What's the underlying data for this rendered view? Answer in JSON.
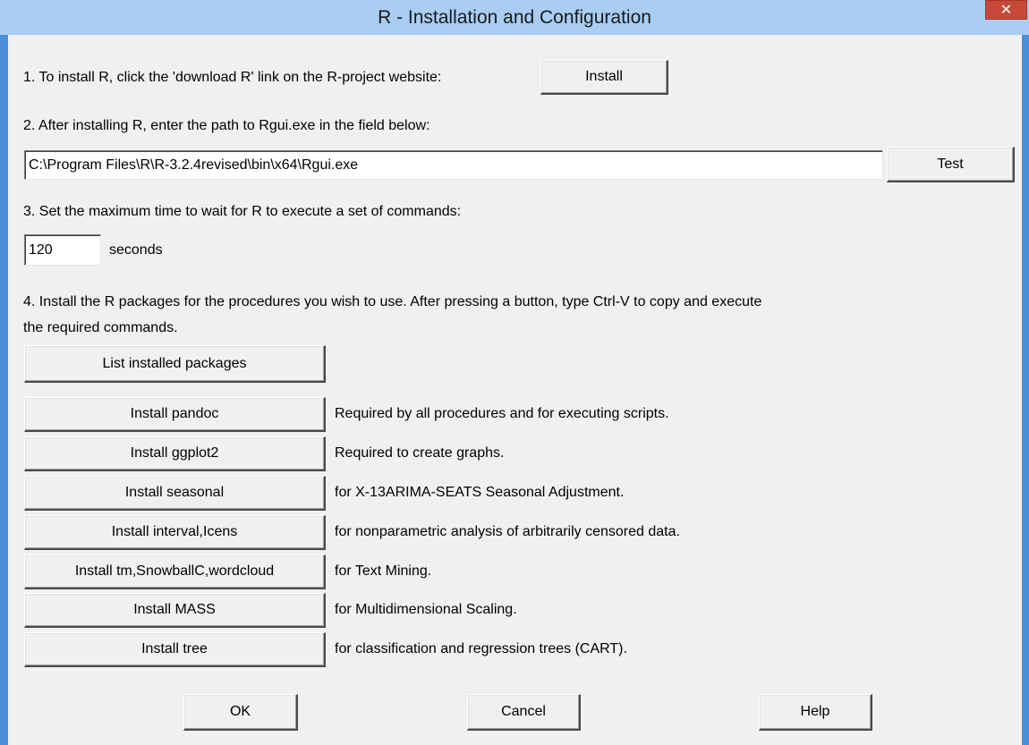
{
  "window": {
    "title": "R - Installation and Configuration",
    "close_glyph": "✕"
  },
  "step1": {
    "label": "1. To install R, click the 'download R' link on the R-project website:",
    "button": "Install"
  },
  "step2": {
    "label": "2. After installing R, enter the path to Rgui.exe in the field below:",
    "path_value": "C:\\Program Files\\R\\R-3.2.4revised\\bin\\x64\\Rgui.exe",
    "test_button": "Test"
  },
  "step3": {
    "label": "3. Set the maximum time to wait for R to execute a set of commands:",
    "seconds_value": "120",
    "seconds_unit": "seconds"
  },
  "step4": {
    "label_line1": "4. Install the R packages for the procedures you wish to use. After pressing a button, type Ctrl-V to copy and execute",
    "label_line2": "the required commands.",
    "list_button": "List installed packages",
    "packages": [
      {
        "button": "Install pandoc",
        "description": "Required by all procedures and for executing scripts."
      },
      {
        "button": "Install ggplot2",
        "description": "Required to create graphs."
      },
      {
        "button": "Install seasonal",
        "description": "for X-13ARIMA-SEATS Seasonal Adjustment."
      },
      {
        "button": "Install interval,Icens",
        "description": "for nonparametric analysis of arbitrarily censored data."
      },
      {
        "button": "Install tm,SnowballC,wordcloud",
        "description": "for Text Mining."
      },
      {
        "button": "Install MASS",
        "description": "for Multidimensional Scaling."
      },
      {
        "button": "Install tree",
        "description": "for classification and regression trees (CART)."
      }
    ]
  },
  "footer": {
    "ok": "OK",
    "cancel": "Cancel",
    "help": "Help"
  }
}
